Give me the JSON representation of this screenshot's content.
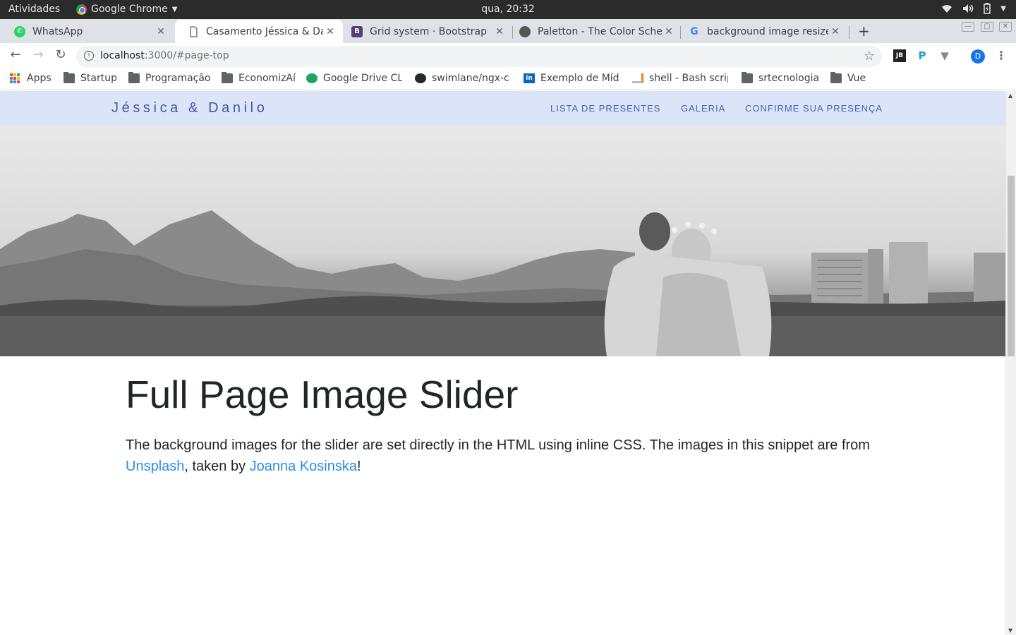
{
  "os_bar": {
    "activities": "Atividades",
    "app_name": "Google Chrome",
    "clock": "qua, 20:32"
  },
  "tabs": [
    {
      "title": "WhatsApp",
      "icon": "whatsapp-icon",
      "active": false
    },
    {
      "title": "Casamento Jéssica & Dan",
      "icon": "page-icon",
      "active": true
    },
    {
      "title": "Grid system · Bootstrap",
      "icon": "bootstrap-icon",
      "active": false
    },
    {
      "title": "Paletton - The Color Scher",
      "icon": "paletton-icon",
      "active": false
    },
    {
      "title": "background image resize",
      "icon": "google-icon",
      "active": false
    }
  ],
  "address_bar": {
    "host": "localhost",
    "path": ":3000/#page-top"
  },
  "profile_initial": "D",
  "bookmarks": [
    {
      "label": "Apps",
      "icon": "apps-icon"
    },
    {
      "label": "Startup",
      "icon": "folder-icon"
    },
    {
      "label": "Programação",
      "icon": "folder-icon"
    },
    {
      "label": "EconomizAí",
      "icon": "folder-icon"
    },
    {
      "label": "Google Drive CLI",
      "icon": "drive-icon"
    },
    {
      "label": "swimlane/ngx-c",
      "icon": "github-icon"
    },
    {
      "label": "Exemplo de Mídi",
      "icon": "linkedin-icon"
    },
    {
      "label": "shell - Bash scrip",
      "icon": "stackoverflow-icon"
    },
    {
      "label": "srtecnologia",
      "icon": "folder-icon"
    },
    {
      "label": "Vue",
      "icon": "folder-icon"
    }
  ],
  "site": {
    "brand": "Jéssica & Danilo",
    "nav": [
      "LISTA DE PRESENTES",
      "GALERIA",
      "CONFIRME SUA PRESENÇA"
    ],
    "heading": "Full Page Image Slider",
    "lead_part1": "The background images for the slider are set directly in the HTML using inline CSS. The images in this snippet are from ",
    "lead_link1": "Unsplash",
    "lead_part2": ", taken by ",
    "lead_link2": "Joanna Kosinska",
    "lead_part3": "!"
  },
  "colors": {
    "nav_bg": "#dce5f7",
    "brand": "#3f5aa5",
    "link": "#2a8de8"
  }
}
